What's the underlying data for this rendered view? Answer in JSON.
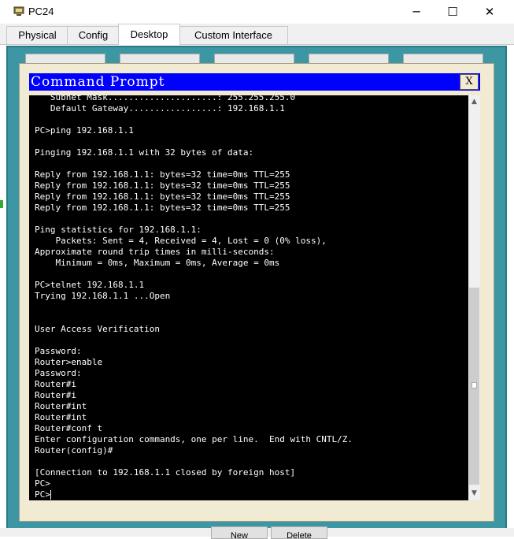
{
  "window": {
    "title": "PC24",
    "minimize": "─",
    "maximize": "☐",
    "close": "✕"
  },
  "tabs": [
    {
      "label": "Physical"
    },
    {
      "label": "Config"
    },
    {
      "label": "Desktop"
    },
    {
      "label": "Custom Interface"
    }
  ],
  "active_tab": "Desktop",
  "cmd": {
    "title": "Command Prompt",
    "close": "X",
    "output": "   Subnet Mask.....................: 255.255.255.0\n   Default Gateway.................: 192.168.1.1\n\nPC>ping 192.168.1.1\n\nPinging 192.168.1.1 with 32 bytes of data:\n\nReply from 192.168.1.1: bytes=32 time=0ms TTL=255\nReply from 192.168.1.1: bytes=32 time=0ms TTL=255\nReply from 192.168.1.1: bytes=32 time=0ms TTL=255\nReply from 192.168.1.1: bytes=32 time=0ms TTL=255\n\nPing statistics for 192.168.1.1:\n    Packets: Sent = 4, Received = 4, Lost = 0 (0% loss),\nApproximate round trip times in milli-seconds:\n    Minimum = 0ms, Maximum = 0ms, Average = 0ms\n\nPC>telnet 192.168.1.1\nTrying 192.168.1.1 ...Open\n\n\nUser Access Verification\n\nPassword:\nRouter>enable\nPassword:\nRouter#i\nRouter#i\nRouter#int\nRouter#int\nRouter#conf t\nEnter configuration commands, one per line.  End with CNTL/Z.\nRouter(config)#\n\n[Connection to 192.168.1.1 closed by foreign host]\nPC>\n",
    "prompt": "PC>"
  },
  "bottom_buttons": {
    "new": "New",
    "delete": "Delete"
  },
  "colors": {
    "desktop_bg": "#3d96a3",
    "cmd_title_bg": "#0000ff",
    "terminal_bg": "#000000"
  }
}
